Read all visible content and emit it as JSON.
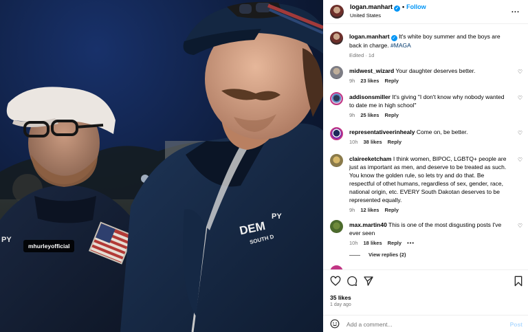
{
  "photo": {
    "tag_label": "mhurleyofficial",
    "jacket_text_right": "PY",
    "jacket_text_right2": "DEM",
    "jacket_text_right3": "SOUTH D",
    "jacket_text_left": "PY"
  },
  "header": {
    "username": "logan.manhart",
    "verified_glyph": "✓",
    "separator": "•",
    "follow_label": "Follow",
    "location": "United States",
    "more_label": "..."
  },
  "caption": {
    "username": "logan.manhart",
    "text": "It's white boy summer and the boys are back in charge.",
    "hashtag": "#MAGA",
    "meta": "Edited · 1d"
  },
  "comments": [
    {
      "username": "midwest_wizard",
      "text": "Your daughter deserves better.",
      "time": "9h",
      "likes": "23 likes",
      "reply": "Reply"
    },
    {
      "username": "addisonsmiller",
      "text": "It's giving \"I don't know why nobody wanted to date me in high school\"",
      "time": "9h",
      "likes": "25 likes",
      "reply": "Reply"
    },
    {
      "username": "representativeerinhealy",
      "text": "Come on, be better.",
      "time": "10h",
      "likes": "38 likes",
      "reply": "Reply"
    },
    {
      "username": "claireeketcham",
      "text": "I think women, BIPOC, LGBTQ+ people are just as important as men, and deserve to be treated as such. You know the golden rule, so lets try and do that. Be respectful of othet humans, regardless of sex, gender, race, national origin, etc. EVERY South Dakotan deserves to be represented equally.",
      "time": "9h",
      "likes": "12 likes",
      "reply": "Reply"
    },
    {
      "username": "max.martin40",
      "text": "This is one of the most disgusting posts I've ever seen",
      "time": "10h",
      "likes": "18 likes",
      "reply": "Reply",
      "more": "•••"
    }
  ],
  "view_replies": "View replies (2)",
  "footer": {
    "likes": "35 likes",
    "time_ago": "1 day ago"
  },
  "add_comment": {
    "placeholder": "Add a comment...",
    "post_label": "Post"
  },
  "icons": [
    "heart-icon",
    "comment-icon",
    "share-icon",
    "bookmark-icon",
    "emoji-icon",
    "more-icon",
    "verified-icon"
  ],
  "colors": {
    "accent": "#0095f6",
    "muted": "#737373",
    "post_disabled": "#b3dbff",
    "hashtag": "#00376b"
  }
}
